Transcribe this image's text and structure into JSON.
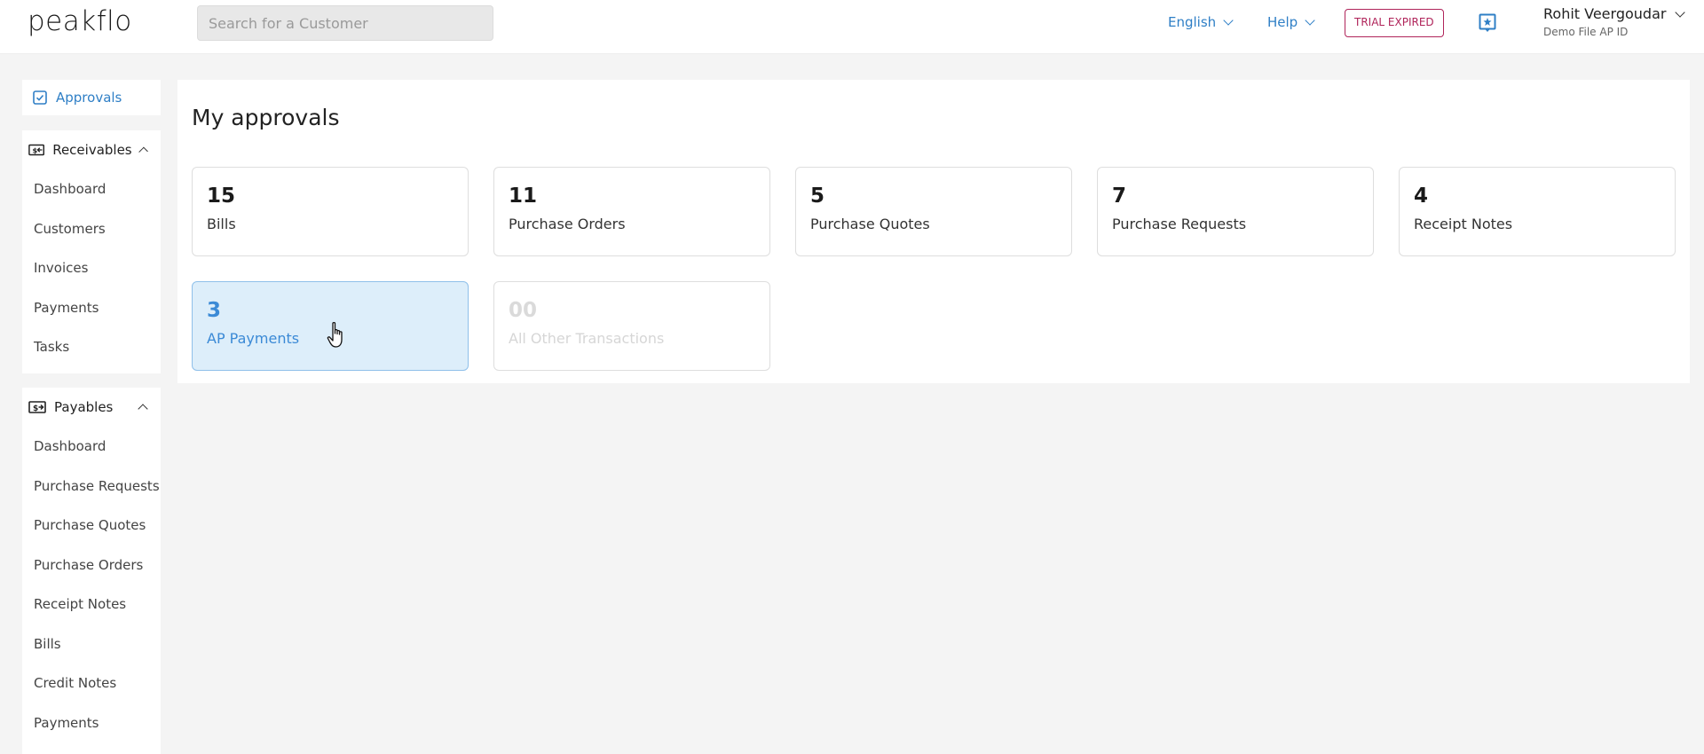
{
  "header": {
    "logo": "peakflo",
    "search_placeholder": "Search for a Customer",
    "language": "English",
    "help": "Help",
    "trial_badge": "TRIAL EXPIRED",
    "user_name": "Rohit Veergoudar",
    "user_sub": "Demo File AP ID",
    "accent_color": "#2f7fc6",
    "badge_color": "#b0245a"
  },
  "sidebar": {
    "approvals": "Approvals",
    "receivables": {
      "title": "Receivables",
      "items": [
        "Dashboard",
        "Customers",
        "Invoices",
        "Payments",
        "Tasks"
      ]
    },
    "payables": {
      "title": "Payables",
      "items": [
        "Dashboard",
        "Purchase Requests",
        "Purchase Quotes",
        "Purchase Orders",
        "Receipt Notes",
        "Bills",
        "Credit Notes",
        "Payments"
      ]
    }
  },
  "main": {
    "title": "My approvals",
    "cards": [
      {
        "count": "15",
        "label": "Bills"
      },
      {
        "count": "11",
        "label": "Purchase Orders"
      },
      {
        "count": "5",
        "label": "Purchase Quotes"
      },
      {
        "count": "7",
        "label": "Purchase Requests"
      },
      {
        "count": "4",
        "label": "Receipt Notes"
      },
      {
        "count": "3",
        "label": "AP Payments"
      },
      {
        "count": "00",
        "label": "All Other Transactions"
      }
    ]
  },
  "icons": {
    "approvals": "checkbox-icon",
    "receivables": "money-in-icon",
    "payables": "money-out-icon",
    "notification": "notification-icon",
    "cursor": "hand-cursor-icon"
  }
}
